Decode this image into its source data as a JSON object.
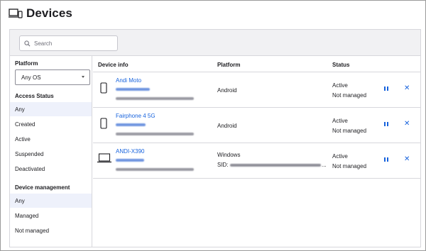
{
  "page": {
    "title": "Devices"
  },
  "search": {
    "placeholder": "Search"
  },
  "sidebar": {
    "platform_title": "Platform",
    "platform_select": "Any OS",
    "access_status_title": "Access Status",
    "access_status_items": [
      "Any",
      "Created",
      "Active",
      "Suspended",
      "Deactivated"
    ],
    "device_management_title": "Device management",
    "device_management_items": [
      "Any",
      "Managed",
      "Not managed"
    ]
  },
  "table": {
    "headers": {
      "device_info": "Device info",
      "platform": "Platform",
      "status": "Status"
    },
    "rows": [
      {
        "name": "Andi Moto",
        "platform": "Android",
        "status": "Active",
        "management": "Not managed",
        "device_type": "phone-icon"
      },
      {
        "name": "Fairphone 4 5G",
        "platform": "Android",
        "status": "Active",
        "management": "Not managed",
        "device_type": "phone-icon"
      },
      {
        "name": "ANDI-X390",
        "platform": "Windows",
        "sid_label": "SID:",
        "sid_ellipsis": "...",
        "status": "Active",
        "management": "Not managed",
        "device_type": "laptop-icon"
      }
    ]
  },
  "colors": {
    "accent": "#1662dd",
    "selected_bg": "#eef1fb",
    "search_bar_bg": "#f1f1f3"
  }
}
